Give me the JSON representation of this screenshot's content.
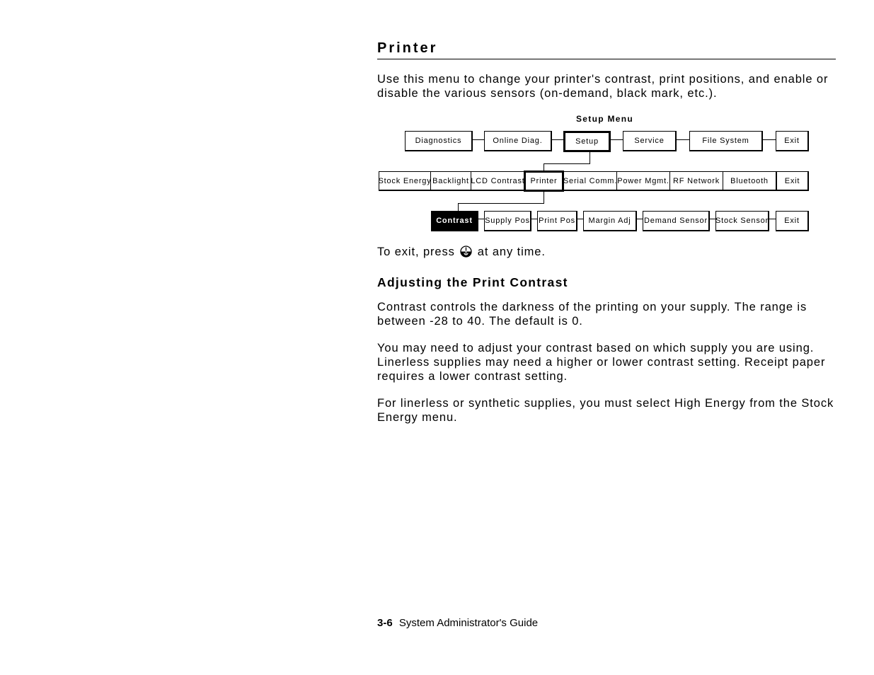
{
  "page": {
    "title": "Printer",
    "intro": "Use this menu to change your printer's contrast, print positions, and enable or disable the various sensors (on-demand, black mark, etc.).",
    "exit_before": "To exit, press ",
    "exit_icon": "escape-key-icon",
    "exit_after": " at any time.",
    "section_heading": "Adjusting the Print Contrast",
    "paragraphs": [
      "Contrast controls the darkness of the printing on your supply.  The range is between -28 to 40.  The default is 0.",
      "You may need to adjust your contrast based on which supply you are using.  Linerless supplies may need a higher or lower contrast setting.  Receipt paper requires a lower contrast setting.",
      "For linerless or synthetic supplies, you must select High Energy from the Stock Energy menu."
    ]
  },
  "diagram": {
    "title": "Setup Menu",
    "level1": [
      "Diagnostics",
      "Online Diag.",
      "Setup",
      "Service",
      "File System",
      "Exit"
    ],
    "level1_active": "Setup",
    "level2": [
      "Stock Energy",
      "Backlight",
      "LCD Contrast",
      "Printer",
      "Serial Comm.",
      "Power Mgmt.",
      "RF Network",
      "Bluetooth",
      "Exit"
    ],
    "level2_active": "Printer",
    "level3": [
      "Contrast",
      "Supply Pos",
      "Print Pos",
      "Margin Adj",
      "Demand Sensor",
      "Stock Sensor",
      "Exit"
    ],
    "level3_selected": "Contrast"
  },
  "footer": {
    "page_number": "3-6",
    "guide_title": "System Administrator's Guide"
  }
}
